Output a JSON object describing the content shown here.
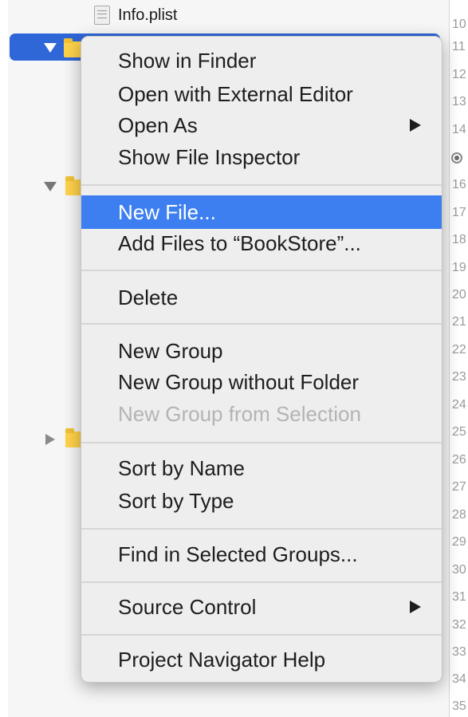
{
  "navigator": {
    "file_row": {
      "icon": "plist-file-icon",
      "name": "Info.plist"
    },
    "folders": [
      {
        "icon": "folder-icon",
        "state": "expanded",
        "selected": true
      },
      {
        "icon": "folder-icon",
        "state": "expanded",
        "selected": false
      },
      {
        "icon": "folder-icon",
        "state": "collapsed",
        "selected": false
      }
    ]
  },
  "editor": {
    "line_numbers": [
      "10",
      "11",
      "12",
      "13",
      "14",
      "",
      "16",
      "17",
      "18",
      "19",
      "20",
      "21",
      "22",
      "23",
      "24",
      "25",
      "26",
      "27",
      "28",
      "29",
      "30",
      "31",
      "32",
      "33",
      "34",
      "35"
    ],
    "breakpoint_marker": "breakpoint-icon"
  },
  "context_menu": {
    "highlight_color": "#3d7ff0",
    "items": [
      {
        "label": "Show in Finder"
      },
      {
        "label": "Open with External Editor"
      },
      {
        "label": "Open As",
        "submenu": true
      },
      {
        "label": "Show File Inspector"
      },
      {
        "label": "New File...",
        "highlighted": true
      },
      {
        "label": "Add Files to “BookStore”..."
      },
      {
        "label": "Delete"
      },
      {
        "label": "New Group"
      },
      {
        "label": "New Group without Folder"
      },
      {
        "label": "New Group from Selection",
        "disabled": true
      },
      {
        "label": "Sort by Name"
      },
      {
        "label": "Sort by Type"
      },
      {
        "label": "Find in Selected Groups..."
      },
      {
        "label": "Source Control",
        "submenu": true
      },
      {
        "label": "Project Navigator Help"
      }
    ]
  }
}
